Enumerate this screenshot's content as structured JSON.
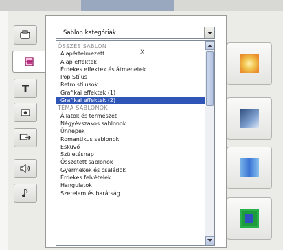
{
  "dropdown": {
    "value": "Sablon kategóriák",
    "arrow_icon": "chevron-down-icon"
  },
  "list": {
    "cursor_mark": "X",
    "items": [
      {
        "text": "ÖSSZES SABLON",
        "header": true,
        "selected": false
      },
      {
        "text": "Alapértelmezett",
        "header": false,
        "selected": false
      },
      {
        "text": "Alap effektek",
        "header": false,
        "selected": false
      },
      {
        "text": "Érdekes effektek és átmenetek",
        "header": false,
        "selected": false
      },
      {
        "text": "Pop Stílus",
        "header": false,
        "selected": false
      },
      {
        "text": "Retro stílusok",
        "header": false,
        "selected": false
      },
      {
        "text": "Grafikai effektek (1)",
        "header": false,
        "selected": false
      },
      {
        "text": "Grafikai effektek (2)",
        "header": false,
        "selected": true
      },
      {
        "text": "TÉMA SABLONOK",
        "header": true,
        "selected": false
      },
      {
        "text": "Állatok és természet",
        "header": false,
        "selected": false
      },
      {
        "text": "Négyévszakos sablonok",
        "header": false,
        "selected": false
      },
      {
        "text": "Ünnepek",
        "header": false,
        "selected": false
      },
      {
        "text": "Romantikus sablonok",
        "header": false,
        "selected": false
      },
      {
        "text": "Esküvő",
        "header": false,
        "selected": false
      },
      {
        "text": "Születésnap",
        "header": false,
        "selected": false
      },
      {
        "text": "Összetett sablonok",
        "header": false,
        "selected": false
      },
      {
        "text": "Gyermekek és családok",
        "header": false,
        "selected": false
      },
      {
        "text": "Érdekes felvételek",
        "header": false,
        "selected": false
      },
      {
        "text": "Hangulatok",
        "header": false,
        "selected": false
      },
      {
        "text": "Szerelem és barátság",
        "header": false,
        "selected": false
      }
    ]
  },
  "tools": [
    {
      "name": "video-tab",
      "icon": "film-icon",
      "active": false
    },
    {
      "name": "template-tab",
      "icon": "template-icon",
      "active": true
    },
    {
      "name": "text-tab",
      "icon": "text-icon",
      "active": false
    },
    {
      "name": "photo-tab",
      "icon": "photo-icon",
      "active": false
    },
    {
      "name": "transition-tab",
      "icon": "transition-icon",
      "active": false
    },
    {
      "name": "audio-tab",
      "icon": "speaker-icon",
      "active": false
    },
    {
      "name": "music-tab",
      "icon": "music-note-icon",
      "active": false
    }
  ],
  "previews": [
    {
      "name": "preview-yellow-glow",
      "colors": [
        "#f0c04a",
        "#fff3b0"
      ]
    },
    {
      "name": "preview-blue-photo",
      "colors": [
        "#2e4f7d",
        "#7ea0cf"
      ]
    },
    {
      "name": "preview-blue-waves",
      "colors": [
        "#3a74d4",
        "#8ac2ee"
      ]
    },
    {
      "name": "preview-green-frame",
      "colors": [
        "#1c9c3c",
        "#2f4fc2"
      ]
    }
  ],
  "colors": {
    "selection": "#2f55b7",
    "header_text": "#8e8e8e"
  }
}
